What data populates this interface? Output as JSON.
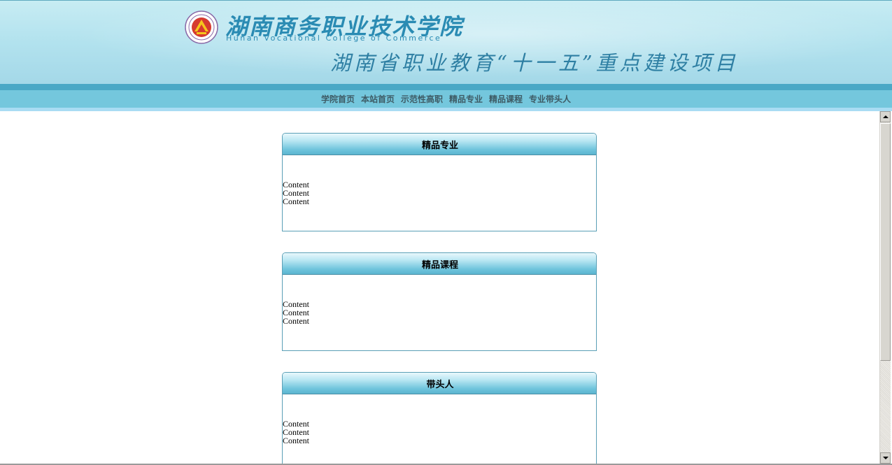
{
  "header": {
    "school_name": "湖南商务职业技术学院",
    "school_name_en": "Hunan Vocational College of Commerce",
    "slogan": "湖南省职业教育“十一五”重点建设项目",
    "colors": {
      "banner": "#b2e2ee",
      "text": "#2a8bb3"
    }
  },
  "nav": {
    "items": [
      {
        "label": "学院首页"
      },
      {
        "label": "本站首页"
      },
      {
        "label": "示范性高职"
      },
      {
        "label": "精品专业"
      },
      {
        "label": "精品课程"
      },
      {
        "label": "专业带头人"
      }
    ]
  },
  "panels": [
    {
      "title": "精品专业",
      "lines": [
        "Content",
        "Content",
        "Content"
      ]
    },
    {
      "title": "精品课程",
      "lines": [
        "Content",
        "Content",
        "Content"
      ]
    },
    {
      "title": "带头人",
      "lines": [
        "Content",
        "Content",
        "Content"
      ]
    }
  ],
  "scrollbar": {
    "up_icon": "arrow-up-icon",
    "down_icon": "arrow-down-icon"
  }
}
